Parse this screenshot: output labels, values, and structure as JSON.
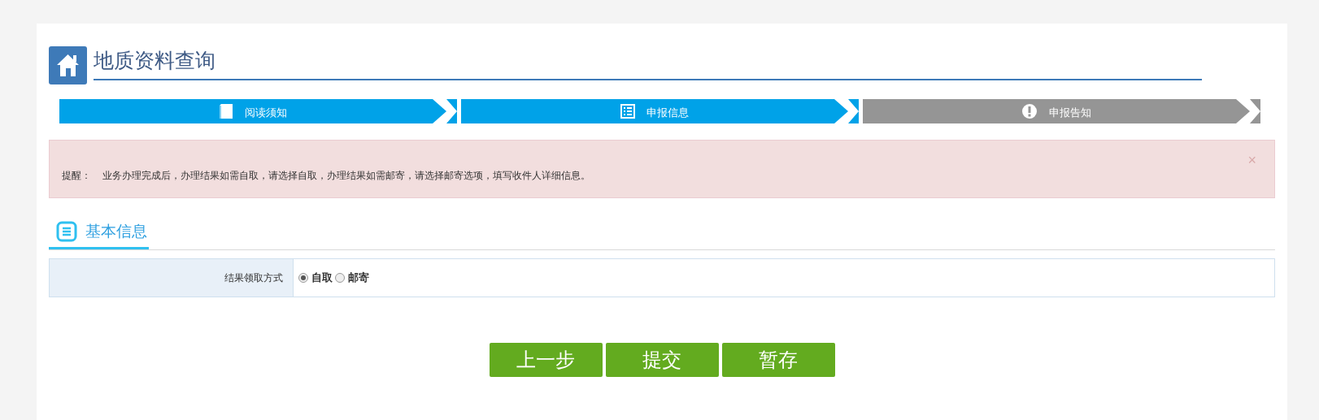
{
  "header": {
    "title": "地质资料查询"
  },
  "steps": [
    {
      "label": "阅读须知",
      "active": true
    },
    {
      "label": "申报信息",
      "active": true
    },
    {
      "label": "申报告知",
      "active": false
    }
  ],
  "alert": {
    "label": "提醒：",
    "message": "业务办理完成后，办理结果如需自取，请选择自取，办理结果如需邮寄，请选择邮寄选项，填写收件人详细信息。",
    "close": "×"
  },
  "section": {
    "title": "基本信息"
  },
  "form": {
    "label": "结果领取方式",
    "options": [
      {
        "label": "自取",
        "selected": true
      },
      {
        "label": "邮寄",
        "selected": false
      }
    ]
  },
  "buttons": [
    "上一步",
    "提交",
    "暂存"
  ]
}
